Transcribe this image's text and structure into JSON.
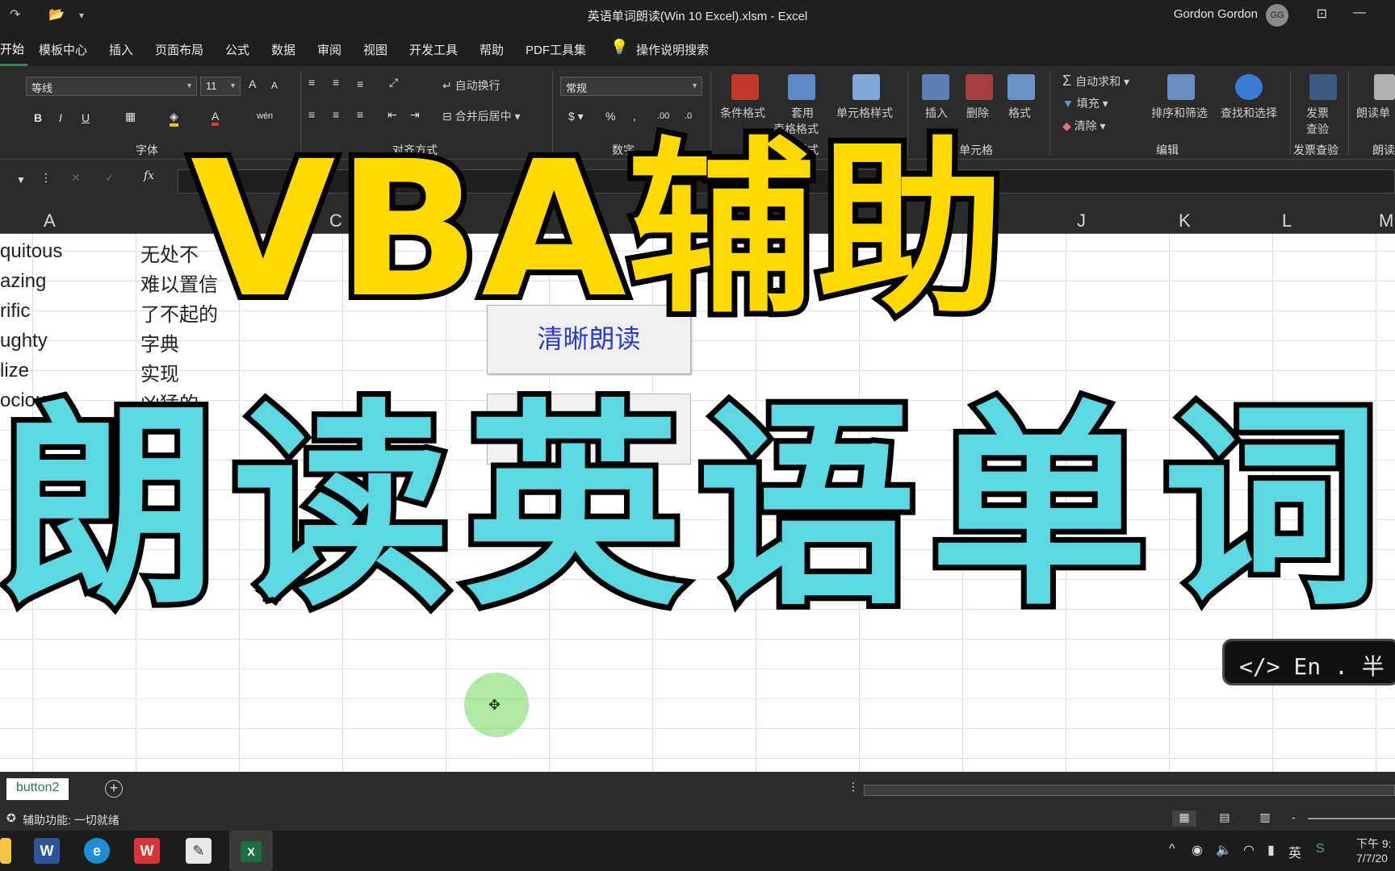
{
  "window": {
    "title": "英语单词朗读(Win 10 Excel).xlsm  -  Excel",
    "user": "Gordon Gordon",
    "avatar_initials": "GG"
  },
  "tabs": [
    "开始",
    "模板中心",
    "插入",
    "页面布局",
    "公式",
    "数据",
    "审阅",
    "视图",
    "开发工具",
    "帮助",
    "PDF工具集"
  ],
  "search": {
    "label": "操作说明搜索"
  },
  "ribbon": {
    "font_name": "等线",
    "font_size": "11",
    "font_group": "字体",
    "align_group": "对齐方式",
    "wrap_text": "自动换行",
    "merge_center": "合并后居中",
    "number_format": "常规",
    "number_group": "数字",
    "cond_format": "条件格式",
    "table_format_1": "套用",
    "table_format_2": "表格格式",
    "cell_styles": "单元格样式",
    "styles_group": "样式",
    "insert": "插入",
    "delete": "删除",
    "format": "格式",
    "cells_group": "单元格",
    "autosum": "自动求和",
    "fill": "填充",
    "clear": "清除",
    "sort_filter": "排序和筛选",
    "find_select": "查找和选择",
    "edit_group": "编辑",
    "invoice_1": "发票",
    "invoice_2": "查验",
    "invoice_group": "发票查验",
    "read_word": "朗读单",
    "read_group": "朗读"
  },
  "columns": [
    "A",
    "C",
    "J",
    "K",
    "L",
    "M"
  ],
  "cells": {
    "colA": [
      "quitous",
      "azing",
      "rific",
      "ughty",
      "lize",
      "ocious"
    ],
    "colB": [
      "无处不",
      "难以置信",
      "了不起的",
      "字典",
      "实现",
      "凶猛的"
    ]
  },
  "vba_button_label": "清晰朗读",
  "overlay": {
    "title": "VBA辅助",
    "subtitle": "朗读英语单词"
  },
  "code_badge": "</> En . 半",
  "sheet_tab": "button2",
  "status": "辅助功能: 一切就绪",
  "taskbar": {
    "ime": "英",
    "time": "下午 9:",
    "date": "7/7/20"
  }
}
